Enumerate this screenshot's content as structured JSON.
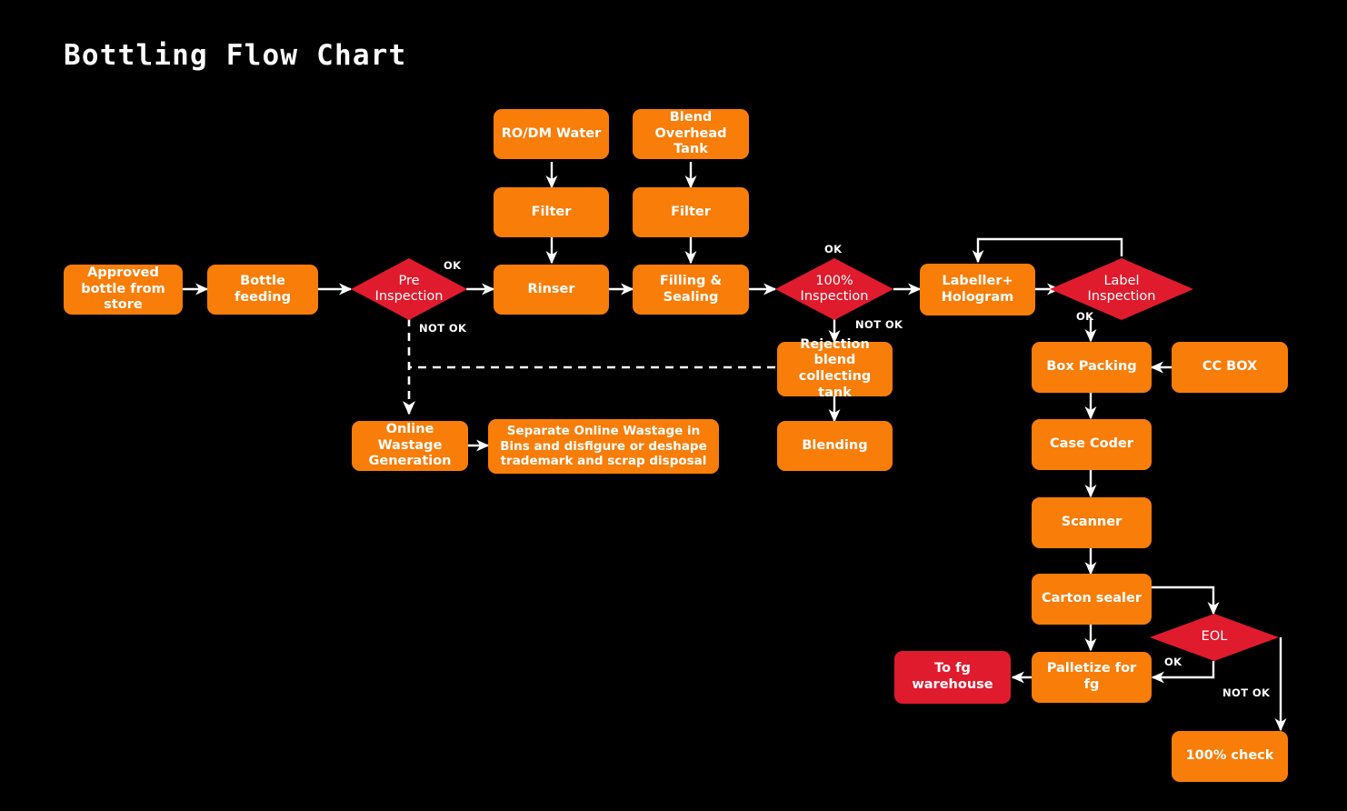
{
  "page": {
    "title": "Bottling Flow Chart",
    "background": "#000000",
    "process_color": "#f97d09",
    "decision_color": "#e01b2d",
    "terminal_color": "#e01b2d",
    "line_color": "#ffffff"
  },
  "nodes": {
    "approved_bottle": "Approved bottle from store",
    "bottle_feeding": "Bottle feeding",
    "pre_inspection": "Pre\nInspection",
    "ro_dm_water": "RO/DM Water",
    "filter_left": "Filter",
    "rinser": "Rinser",
    "blend_overhead_tank": "Blend Overhead Tank",
    "filter_right": "Filter",
    "filling_sealing": "Filling & Sealing",
    "inspection_100": "100%\nInspection",
    "labeller_hologram": "Labeller+ Hologram",
    "label_inspection": "Label\nInspection",
    "box_packing": "Box Packing",
    "cc_box": "CC BOX",
    "case_coder": "Case Coder",
    "scanner": "Scanner",
    "carton_sealer": "Carton sealer",
    "eol": "EOL",
    "palletize_for_fg": "Palletize for fg",
    "to_fg_warehouse": "To fg warehouse",
    "check_100": "100% check",
    "online_wastage_generation": "Online Wastage Generation",
    "separate_online_wastage": "Separate Online Wastage in Bins and disfigure or deshape trademark and scrap disposal",
    "rejection_blend_tank": "Rejection blend collecting tank",
    "blending": "Blending"
  },
  "edge_labels": {
    "pre_inspection_ok": "OK",
    "pre_inspection_not_ok": "NOT OK",
    "inspection_100_ok": "OK",
    "inspection_100_not_ok": "NOT OK",
    "label_inspection_ok": "OK",
    "eol_ok": "OK",
    "eol_not_ok": "NOT OK"
  },
  "chart_data": {
    "type": "diagram",
    "title": "Bottling Flow Chart",
    "flow": [
      {
        "from": "Approved bottle from store",
        "to": "Bottle feeding",
        "style": "solid"
      },
      {
        "from": "Bottle feeding",
        "to": "Pre Inspection",
        "style": "solid"
      },
      {
        "from": "Pre Inspection",
        "to": "Rinser",
        "label": "OK",
        "style": "solid"
      },
      {
        "from": "Pre Inspection",
        "to": "Online Wastage Generation",
        "label": "NOT OK",
        "style": "dashed"
      },
      {
        "from": "RO/DM Water",
        "to": "Filter",
        "style": "solid"
      },
      {
        "from": "Filter",
        "to": "Rinser",
        "style": "solid"
      },
      {
        "from": "Blend Overhead Tank",
        "to": "Filter",
        "style": "solid"
      },
      {
        "from": "Filter",
        "to": "Filling & Sealing",
        "style": "solid"
      },
      {
        "from": "Rinser",
        "to": "Filling & Sealing",
        "style": "solid"
      },
      {
        "from": "Filling & Sealing",
        "to": "100% Inspection",
        "style": "solid"
      },
      {
        "from": "100% Inspection",
        "to": "Labeller+ Hologram",
        "label": "OK",
        "style": "solid"
      },
      {
        "from": "100% Inspection",
        "to": "Rejection blend collecting tank",
        "label": "NOT OK",
        "style": "solid"
      },
      {
        "from": "Rejection blend collecting tank",
        "to": "Blending",
        "style": "solid"
      },
      {
        "from": "Rejection blend collecting tank",
        "to": "Online Wastage Generation",
        "style": "dashed"
      },
      {
        "from": "Online Wastage Generation",
        "to": "Separate Online Wastage in Bins and disfigure or deshape trademark and scrap disposal",
        "style": "solid"
      },
      {
        "from": "Labeller+ Hologram",
        "to": "Label Inspection",
        "style": "solid"
      },
      {
        "from": "Label Inspection",
        "to": "Labeller+ Hologram",
        "style": "solid"
      },
      {
        "from": "Label Inspection",
        "to": "Box Packing",
        "label": "OK",
        "style": "solid"
      },
      {
        "from": "CC BOX",
        "to": "Box Packing",
        "style": "solid"
      },
      {
        "from": "Box Packing",
        "to": "Case Coder",
        "style": "solid"
      },
      {
        "from": "Case Coder",
        "to": "Scanner",
        "style": "solid"
      },
      {
        "from": "Scanner",
        "to": "Carton sealer",
        "style": "solid"
      },
      {
        "from": "Carton sealer",
        "to": "Palletize for fg",
        "style": "solid"
      },
      {
        "from": "Carton sealer",
        "to": "EOL",
        "style": "solid"
      },
      {
        "from": "EOL",
        "to": "Palletize for fg",
        "label": "OK",
        "style": "solid"
      },
      {
        "from": "EOL",
        "to": "100% check",
        "label": "NOT OK",
        "style": "solid"
      },
      {
        "from": "Palletize for fg",
        "to": "To fg warehouse",
        "style": "solid"
      }
    ]
  }
}
